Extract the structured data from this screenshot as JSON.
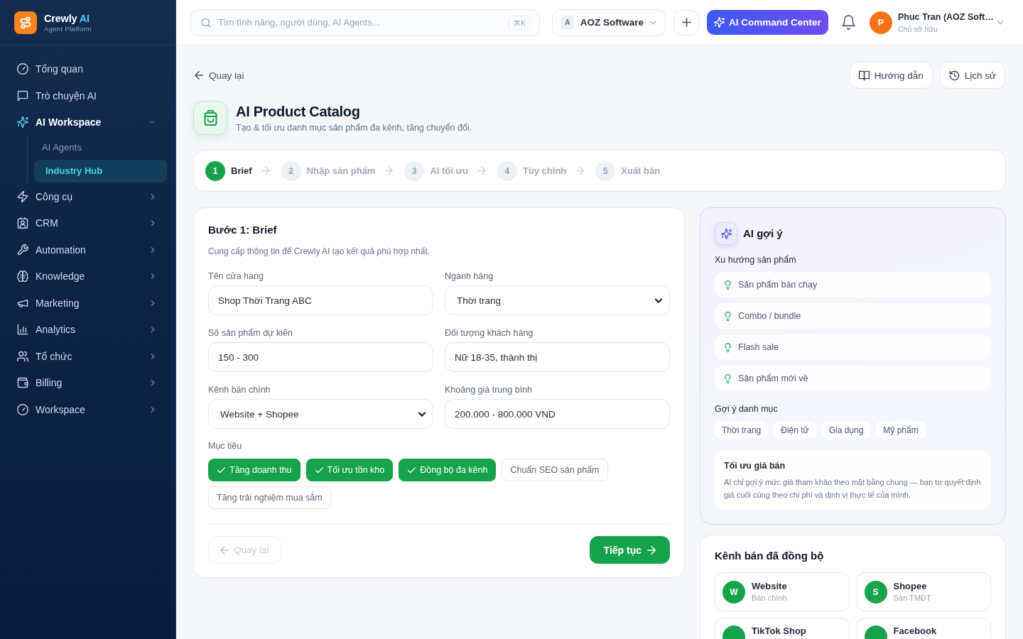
{
  "sidebar": {
    "brand": {
      "name": "Crewly",
      "accent": "AI",
      "tagline": "Agent Platform"
    },
    "items": [
      {
        "label": "Tổng quan",
        "kind": "link",
        "selected": false
      },
      {
        "label": "Trò chuyện AI",
        "kind": "link",
        "selected": false
      },
      {
        "label": "AI Workspace",
        "kind": "group",
        "expanded": true,
        "selected": false,
        "children": [
          {
            "label": "AI Agents",
            "selected": false
          },
          {
            "label": "Industry Hub",
            "selected": true
          }
        ]
      },
      {
        "label": "Công cụ",
        "kind": "group",
        "expanded": false,
        "selected": false
      },
      {
        "label": "CRM",
        "kind": "group",
        "expanded": false,
        "selected": false
      },
      {
        "label": "Automation",
        "kind": "group",
        "expanded": false,
        "selected": false
      },
      {
        "label": "Knowledge",
        "kind": "group",
        "expanded": false,
        "selected": false
      },
      {
        "label": "Marketing",
        "kind": "group",
        "expanded": false,
        "selected": false
      },
      {
        "label": "Analytics",
        "kind": "group",
        "expanded": false,
        "selected": false
      },
      {
        "label": "Tổ chức",
        "kind": "group",
        "expanded": false,
        "selected": false
      },
      {
        "label": "Billing",
        "kind": "group",
        "expanded": false,
        "selected": false
      },
      {
        "label": "Workspace",
        "kind": "group",
        "expanded": false,
        "selected": false
      }
    ]
  },
  "topbar": {
    "search": {
      "placeholder": "Tìm tính năng, người dùng, AI Agents...",
      "shortcut": "⌘K"
    },
    "workspace": {
      "initial": "A",
      "name": "AOZ Software"
    },
    "command_button": "AI Command Center",
    "user": {
      "initial": "P",
      "name": "Phuc Tran (AOZ Soft…",
      "role": "Chủ sở hữu"
    }
  },
  "page": {
    "back_link": "Quay lại",
    "actions": [
      "Hướng dẫn",
      "Lịch sử"
    ],
    "title": "AI Product Catalog",
    "subtitle": "Tạo & tối ưu danh mục sản phẩm đa kênh, tăng chuyển đổi.",
    "steps": [
      {
        "number": "1",
        "label": "Brief",
        "selected": true
      },
      {
        "number": "2",
        "label": "Nhập sản phẩm",
        "selected": false
      },
      {
        "number": "3",
        "label": "AI tối ưu",
        "selected": false
      },
      {
        "number": "4",
        "label": "Tùy chỉnh",
        "selected": false
      },
      {
        "number": "5",
        "label": "Xuất bản",
        "selected": false
      }
    ]
  },
  "form": {
    "title": "Bước 1: Brief",
    "description": "Cung cấp thông tin để Crewly AI tạo kết quả phù hợp nhất.",
    "fields": [
      {
        "label": "Tên cửa hàng",
        "kind": "text",
        "value": "Shop Thời Trang ABC"
      },
      {
        "label": "Ngành hàng",
        "kind": "select",
        "value": "Thời trang"
      },
      {
        "label": "Số sản phẩm dự kiến",
        "kind": "text",
        "value": "150 - 300"
      },
      {
        "label": "Đối tượng khách hàng",
        "kind": "text",
        "value": "Nữ 18-35, thành thị"
      },
      {
        "label": "Kênh bán chính",
        "kind": "select",
        "value": "Website + Shopee"
      },
      {
        "label": "Khoảng giá trung bình",
        "kind": "text",
        "value": "200.000 - 800.000 VND"
      }
    ],
    "goals": {
      "label": "Mục tiêu",
      "options": [
        {
          "label": "Tăng doanh thu",
          "checked": true
        },
        {
          "label": "Tối ưu tồn kho",
          "checked": true
        },
        {
          "label": "Đồng bộ đa kênh",
          "checked": true
        },
        {
          "label": "Chuẩn SEO sản phẩm",
          "checked": false
        },
        {
          "label": "Tăng trải nghiệm mua sắm",
          "checked": false
        }
      ]
    },
    "back_button": {
      "label": "Quay lại",
      "disabled": true
    },
    "next_button": "Tiếp tục"
  },
  "ai_panel": {
    "title": "AI gợi ý",
    "trends_title": "Xu hướng sản phẩm",
    "trends": [
      "Sản phẩm bán chạy",
      "Combo / bundle",
      "Flash sale",
      "Sản phẩm mới về"
    ],
    "categories_title": "Gợi ý danh mục",
    "categories": [
      "Thời trang",
      "Điện tử",
      "Gia dụng",
      "Mỹ phẩm"
    ],
    "tip": {
      "title": "Tối ưu giá bán",
      "text": "AI chỉ gợi ý mức giá tham khảo theo mặt bằng chung — bạn tự quyết định giá cuối cùng theo chi phí và định vị thực tế của mình."
    }
  },
  "channels": {
    "title": "Kênh bán đã đồng bộ",
    "items": [
      {
        "initial": "W",
        "name": "Website",
        "note": "Bán chính"
      },
      {
        "initial": "S",
        "name": "Shopee",
        "note": "Sàn TMĐT"
      },
      {
        "name": "TikTok Shop"
      },
      {
        "name": "Facebook"
      }
    ]
  }
}
